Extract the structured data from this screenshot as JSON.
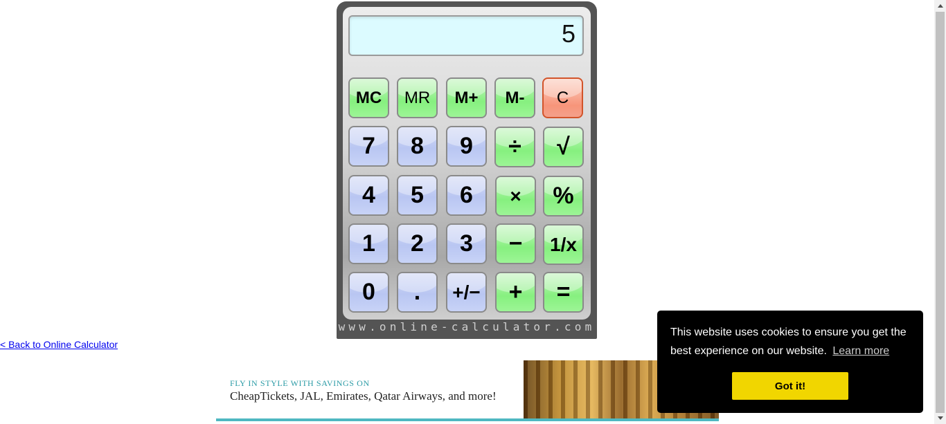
{
  "calculator": {
    "display": "5",
    "brand": "www.online-calculator.com",
    "keys": {
      "mc": "MC",
      "mr": "MR",
      "mplus": "M+",
      "mminus": "M-",
      "clear": "C",
      "k7": "7",
      "k8": "8",
      "k9": "9",
      "divide": "÷",
      "sqrt": "√",
      "k4": "4",
      "k5": "5",
      "k6": "6",
      "multiply": "×",
      "percent": "%",
      "k1": "1",
      "k2": "2",
      "k3": "3",
      "minus": "−",
      "reciprocal": "1/x",
      "k0": "0",
      "decimal": ".",
      "plusminus": "+/−",
      "plus": "+",
      "equals": "="
    }
  },
  "back_link": "< Back to Online Calculator",
  "ad": {
    "tagline": "FLY IN STYLE WITH SAVINGS ON",
    "text": "CheapTickets, JAL, Emirates, Qatar Airways, and more!"
  },
  "cookie": {
    "message": "This website uses cookies to ensure you get the best experience on our website.",
    "learn_more": "Learn more",
    "button": "Got it!"
  },
  "colors": {
    "display_bg": "#dcfbff",
    "number_key": "#b9c6f2",
    "operator_key": "#86f07f",
    "clear_key": "#f7957a",
    "cookie_button": "#f1d600",
    "link": "#0000ee"
  }
}
